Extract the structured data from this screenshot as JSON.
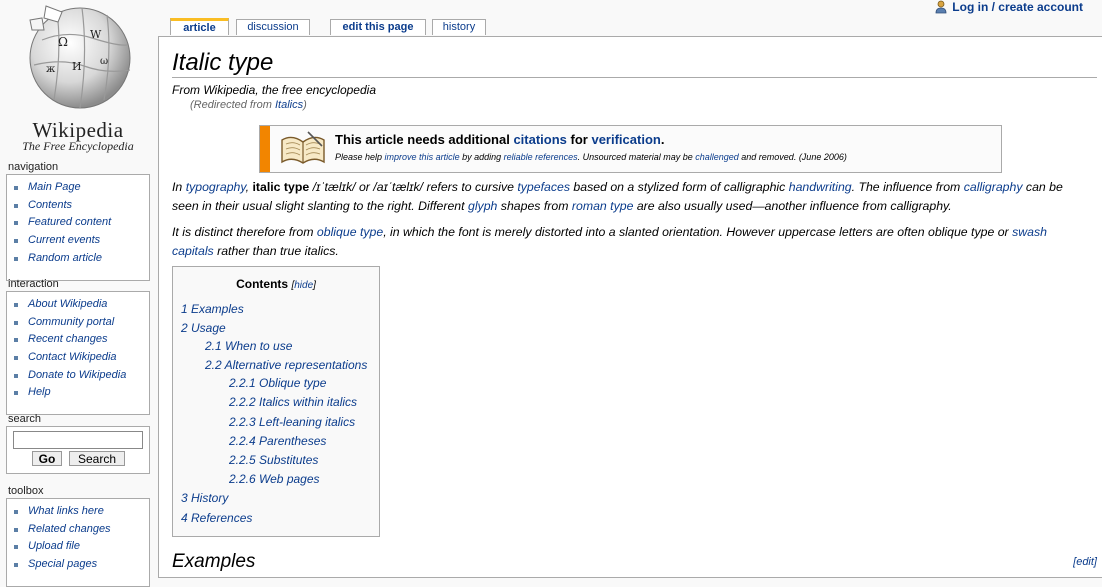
{
  "logo": {
    "wordmark": "Wikipedia",
    "tagline": "The Free Encyclopedia"
  },
  "personal": {
    "login_label": "Log in / create account"
  },
  "tabs": [
    {
      "label": "article"
    },
    {
      "label": "discussion"
    },
    {
      "label": "edit this page"
    },
    {
      "label": "history"
    }
  ],
  "sidebar": {
    "navigation": {
      "heading": "navigation",
      "items": [
        "Main Page",
        "Contents",
        "Featured content",
        "Current events",
        "Random article"
      ]
    },
    "interaction": {
      "heading": "interaction",
      "items": [
        "About Wikipedia",
        "Community portal",
        "Recent changes",
        "Contact Wikipedia",
        "Donate to Wikipedia",
        "Help"
      ]
    },
    "search": {
      "heading": "search",
      "value": "",
      "go_label": "Go",
      "search_label": "Search"
    },
    "toolbox": {
      "heading": "toolbox",
      "items": [
        "What links here",
        "Related changes",
        "Upload file",
        "Special pages"
      ]
    }
  },
  "article": {
    "title": "Italic type",
    "from": "From Wikipedia, the free encyclopedia",
    "redirect_prefix": "(Redirected from ",
    "redirect_link": "Italics",
    "redirect_suffix": ")",
    "notice": {
      "bold_pre": "This article needs additional ",
      "link1": "citations",
      "bold_mid": " for ",
      "link2": "verification",
      "bold_end": ".",
      "s1": "Please help ",
      "l1": "improve this article",
      "s2": " by adding ",
      "l2": "reliable references",
      "s3": ". Unsourced material may be ",
      "l3": "challenged",
      "s4": " and removed. (June 2006)"
    },
    "p1": {
      "t0": "In ",
      "l0": "typography",
      "t1": ", ",
      "b0": "italic type",
      "t2": " /ɪˈtælɪk/ or /aɪˈtælɪk/ refers to cursive ",
      "l1": "typefaces",
      "t3": " based on a stylized form of calligraphic ",
      "l2": "handwriting",
      "t4": ". The influence from ",
      "l3": "calligraphy",
      "t5": " can be seen in their usual slight slanting to the right. Different ",
      "l4": "glyph",
      "t6": " shapes from ",
      "l5": "roman type",
      "t7": " are also usually used—another influence from calligraphy."
    },
    "p2": {
      "t0": "It is distinct therefore from ",
      "l0": "oblique type",
      "t1": ", in which the font is merely distorted into a slanted orientation. However uppercase letters are often oblique type or ",
      "l1": "swash capitals",
      "t2": " rather than true italics."
    },
    "toc": {
      "title": "Contents",
      "hide_pre": "[",
      "hide": "hide",
      "hide_post": "]",
      "items": [
        {
          "text": "1 Examples",
          "level": 1
        },
        {
          "text": "2 Usage",
          "level": 1
        },
        {
          "text": "2.1 When to use",
          "level": 2
        },
        {
          "text": "2.2 Alternative representations",
          "level": 2
        },
        {
          "text": "2.2.1 Oblique type",
          "level": 3
        },
        {
          "text": "2.2.2 Italics within italics",
          "level": 3
        },
        {
          "text": "2.2.3 Left-leaning italics",
          "level": 3
        },
        {
          "text": "2.2.4 Parentheses",
          "level": 3
        },
        {
          "text": "2.2.5 Substitutes",
          "level": 3
        },
        {
          "text": "2.2.6 Web pages",
          "level": 3
        },
        {
          "text": "3 History",
          "level": 1
        },
        {
          "text": "4 References",
          "level": 1
        }
      ]
    },
    "section_heading": "Examples",
    "edit_link": "[edit]"
  }
}
